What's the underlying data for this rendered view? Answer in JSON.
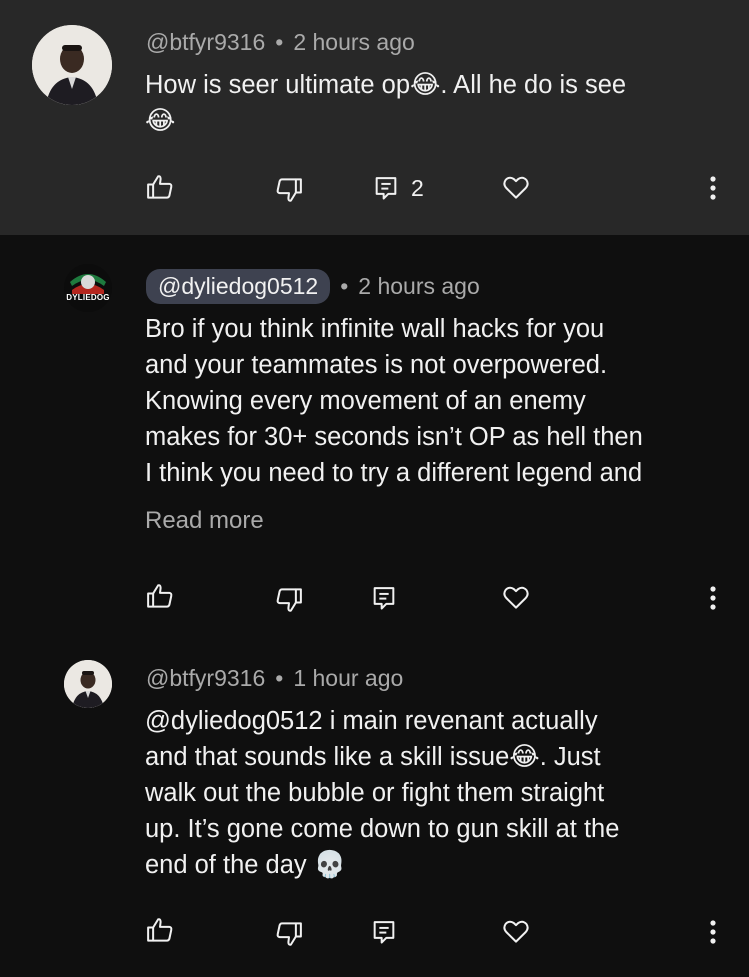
{
  "comments": [
    {
      "handle": "@btfyr9316",
      "separator": "•",
      "time": "2 hours ago",
      "line1_text": "How is seer ultimate op",
      "line1_emoji": "😂",
      "line1_rest": ". All he do is see",
      "line2_emoji": "😂",
      "reply_count": "2"
    },
    {
      "handle": "@dyliedog0512",
      "separator": "•",
      "time": "2 hours ago",
      "lines": [
        "Bro if you think infinite wall hacks for you",
        "and your teammates is not overpowered.",
        "Knowing every movement of an enemy",
        "makes for 30+ seconds isn’t OP as hell then",
        "I think you need to try a different legend and"
      ],
      "read_more": "Read more",
      "avatar_text": "DYLIEDOG"
    },
    {
      "handle": "@btfyr9316",
      "separator": "•",
      "time": "1 hour ago",
      "line1": " @dyliedog0512  i main revenant actually",
      "line2_text": "and that sounds like a skill issue",
      "line2_emoji": "😂",
      "line2_rest": ". Just",
      "line3": "walk out the bubble or fight them straight",
      "line4": "up. It’s gone come down to gun skill at the",
      "line5_text": "end of the day ",
      "line5_emoji": "💀"
    }
  ],
  "icons": {
    "like": "thumbs-up-icon",
    "dislike": "thumbs-down-icon",
    "reply": "reply-icon",
    "heart": "heart-icon",
    "more": "more-vertical-icon"
  }
}
